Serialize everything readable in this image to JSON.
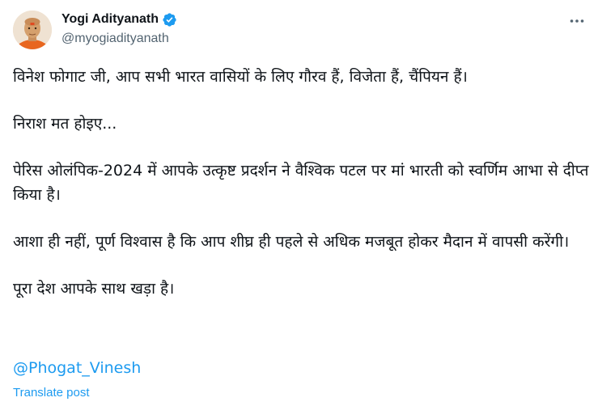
{
  "author": {
    "name": "Yogi Adityanath",
    "handle": "@myogiadityanath"
  },
  "post": {
    "paragraphs": [
      "विनेश फोगाट जी, आप सभी भारत वासियों के लिए गौरव हैं, विजेता हैं, चैंपियन हैं।",
      "निराश मत होइए...",
      "पेरिस ओलंपिक-2024 में आपके उत्कृष्ट प्रदर्शन ने वैश्विक पटल पर मां भारती को स्वर्णिम आभा से दीप्त किया है।",
      "आशा ही नहीं, पूर्ण विश्वास है कि आप शीघ्र ही पहले से अधिक मजबूत होकर मैदान में वापसी करेंगी।",
      "पूरा देश आपके साथ खड़ा है।"
    ],
    "mention": "@Phogat_Vinesh",
    "translate_label": "Translate post"
  },
  "icons": {
    "verified": "verified-badge-icon",
    "more": "more-options-icon"
  },
  "colors": {
    "link": "#1d9bf0",
    "text": "#0f1419",
    "secondary": "#536471"
  }
}
